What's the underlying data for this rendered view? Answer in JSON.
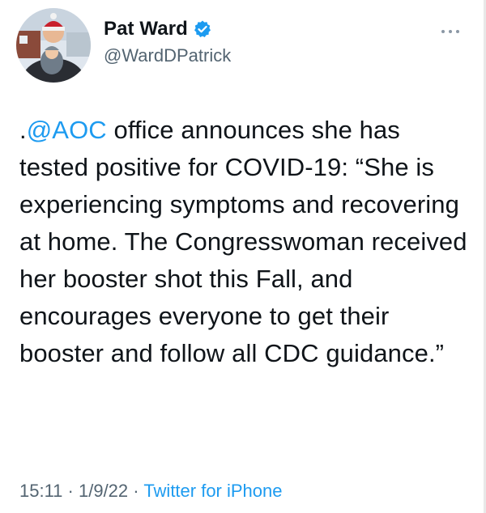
{
  "author": {
    "display_name": "Pat Ward",
    "handle": "@WardDPatrick",
    "verified": true,
    "avatar_icon": "profile-photo"
  },
  "more_icon": "ellipsis-icon",
  "tweet": {
    "mention": "@AOC",
    "text_prefix": ".",
    "text_rest": " office announces she has tested positive for COVID-19: “She is experiencing symptoms and recovering at home. The Congresswoman received her booster shot this Fall, and encourages everyone to get their booster and follow all CDC guidance.”"
  },
  "meta": {
    "time": "15:11",
    "date": "1/9/22",
    "separator": " · ",
    "source": "Twitter for iPhone"
  },
  "colors": {
    "link": "#1d9bf0",
    "secondary": "#536471",
    "text": "#0f1419"
  }
}
